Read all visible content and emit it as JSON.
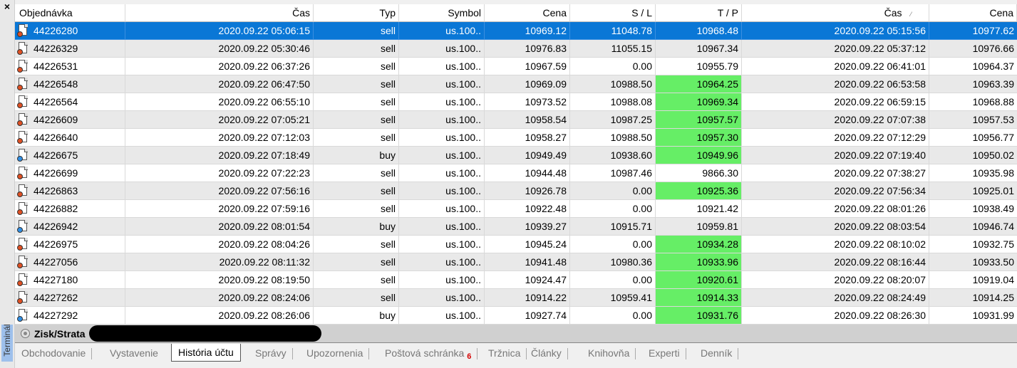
{
  "window": {
    "close_glyph": "×",
    "side_label": "Terminál"
  },
  "columns": [
    "Objednávka",
    "Čas",
    "Typ",
    "Symbol",
    "Cena",
    "S / L",
    "T / P",
    "Čas",
    "Cena"
  ],
  "sort_indicator": "⁄",
  "rows": [
    {
      "order": "44226280",
      "open_time": "2020.09.22 05:06:15",
      "type": "sell",
      "symbol": "us.100..",
      "price": "10969.12",
      "sl": "11048.78",
      "tp": "10968.48",
      "close_time": "2020.09.22 05:15:56",
      "close_price": "10977.62",
      "tp_hit": false,
      "selected": true
    },
    {
      "order": "44226329",
      "open_time": "2020.09.22 05:30:46",
      "type": "sell",
      "symbol": "us.100..",
      "price": "10976.83",
      "sl": "11055.15",
      "tp": "10967.34",
      "close_time": "2020.09.22 05:37:12",
      "close_price": "10976.66",
      "tp_hit": false,
      "selected": false
    },
    {
      "order": "44226531",
      "open_time": "2020.09.22 06:37:26",
      "type": "sell",
      "symbol": "us.100..",
      "price": "10967.59",
      "sl": "0.00",
      "tp": "10955.79",
      "close_time": "2020.09.22 06:41:01",
      "close_price": "10964.37",
      "tp_hit": false,
      "selected": false
    },
    {
      "order": "44226548",
      "open_time": "2020.09.22 06:47:50",
      "type": "sell",
      "symbol": "us.100..",
      "price": "10969.09",
      "sl": "10988.50",
      "tp": "10964.25",
      "close_time": "2020.09.22 06:53:58",
      "close_price": "10963.39",
      "tp_hit": true,
      "selected": false
    },
    {
      "order": "44226564",
      "open_time": "2020.09.22 06:55:10",
      "type": "sell",
      "symbol": "us.100..",
      "price": "10973.52",
      "sl": "10988.08",
      "tp": "10969.34",
      "close_time": "2020.09.22 06:59:15",
      "close_price": "10968.88",
      "tp_hit": true,
      "selected": false
    },
    {
      "order": "44226609",
      "open_time": "2020.09.22 07:05:21",
      "type": "sell",
      "symbol": "us.100..",
      "price": "10958.54",
      "sl": "10987.25",
      "tp": "10957.57",
      "close_time": "2020.09.22 07:07:38",
      "close_price": "10957.53",
      "tp_hit": true,
      "selected": false
    },
    {
      "order": "44226640",
      "open_time": "2020.09.22 07:12:03",
      "type": "sell",
      "symbol": "us.100..",
      "price": "10958.27",
      "sl": "10988.50",
      "tp": "10957.30",
      "close_time": "2020.09.22 07:12:29",
      "close_price": "10956.77",
      "tp_hit": true,
      "selected": false
    },
    {
      "order": "44226675",
      "open_time": "2020.09.22 07:18:49",
      "type": "buy",
      "symbol": "us.100..",
      "price": "10949.49",
      "sl": "10938.60",
      "tp": "10949.96",
      "close_time": "2020.09.22 07:19:40",
      "close_price": "10950.02",
      "tp_hit": true,
      "selected": false
    },
    {
      "order": "44226699",
      "open_time": "2020.09.22 07:22:23",
      "type": "sell",
      "symbol": "us.100..",
      "price": "10944.48",
      "sl": "10987.46",
      "tp": "9866.30",
      "close_time": "2020.09.22 07:38:27",
      "close_price": "10935.98",
      "tp_hit": false,
      "selected": false
    },
    {
      "order": "44226863",
      "open_time": "2020.09.22 07:56:16",
      "type": "sell",
      "symbol": "us.100..",
      "price": "10926.78",
      "sl": "0.00",
      "tp": "10925.36",
      "close_time": "2020.09.22 07:56:34",
      "close_price": "10925.01",
      "tp_hit": true,
      "selected": false
    },
    {
      "order": "44226882",
      "open_time": "2020.09.22 07:59:16",
      "type": "sell",
      "symbol": "us.100..",
      "price": "10922.48",
      "sl": "0.00",
      "tp": "10921.42",
      "close_time": "2020.09.22 08:01:26",
      "close_price": "10938.49",
      "tp_hit": false,
      "selected": false
    },
    {
      "order": "44226942",
      "open_time": "2020.09.22 08:01:54",
      "type": "buy",
      "symbol": "us.100..",
      "price": "10939.27",
      "sl": "10915.71",
      "tp": "10959.81",
      "close_time": "2020.09.22 08:03:54",
      "close_price": "10946.74",
      "tp_hit": false,
      "selected": false
    },
    {
      "order": "44226975",
      "open_time": "2020.09.22 08:04:26",
      "type": "sell",
      "symbol": "us.100..",
      "price": "10945.24",
      "sl": "0.00",
      "tp": "10934.28",
      "close_time": "2020.09.22 08:10:02",
      "close_price": "10932.75",
      "tp_hit": true,
      "selected": false
    },
    {
      "order": "44227056",
      "open_time": "2020.09.22 08:11:32",
      "type": "sell",
      "symbol": "us.100..",
      "price": "10941.48",
      "sl": "10980.36",
      "tp": "10933.96",
      "close_time": "2020.09.22 08:16:44",
      "close_price": "10933.50",
      "tp_hit": true,
      "selected": false
    },
    {
      "order": "44227180",
      "open_time": "2020.09.22 08:19:50",
      "type": "sell",
      "symbol": "us.100..",
      "price": "10924.47",
      "sl": "0.00",
      "tp": "10920.61",
      "close_time": "2020.09.22 08:20:07",
      "close_price": "10919.04",
      "tp_hit": true,
      "selected": false
    },
    {
      "order": "44227262",
      "open_time": "2020.09.22 08:24:06",
      "type": "sell",
      "symbol": "us.100..",
      "price": "10914.22",
      "sl": "10959.41",
      "tp": "10914.33",
      "close_time": "2020.09.22 08:24:49",
      "close_price": "10914.25",
      "tp_hit": true,
      "selected": false
    },
    {
      "order": "44227292",
      "open_time": "2020.09.22 08:26:06",
      "type": "buy",
      "symbol": "us.100..",
      "price": "10927.74",
      "sl": "0.00",
      "tp": "10931.76",
      "close_time": "2020.09.22 08:26:30",
      "close_price": "10931.99",
      "tp_hit": true,
      "selected": false
    }
  ],
  "summary": {
    "label": "Zisk/Strata"
  },
  "tabs": [
    {
      "label": "Obchodovanie",
      "active": false
    },
    {
      "label": "Vystavenie",
      "active": false
    },
    {
      "label": "História účtu",
      "active": true
    },
    {
      "label": "Správy",
      "active": false
    },
    {
      "label": "Upozornenia",
      "active": false
    },
    {
      "label": "Poštová schránka",
      "active": false,
      "badge": "6"
    },
    {
      "label": "Tržnica",
      "active": false
    },
    {
      "label": "Články",
      "active": false
    },
    {
      "label": "Knihovňa",
      "active": false
    },
    {
      "label": "Experti",
      "active": false
    },
    {
      "label": "Denník",
      "active": false
    }
  ],
  "colors": {
    "selected_row": "#0a77d6",
    "tp_hit": "#66ee66",
    "sell_dot": "#e05023",
    "buy_dot": "#2f8fe6",
    "badge": "#d40000"
  }
}
